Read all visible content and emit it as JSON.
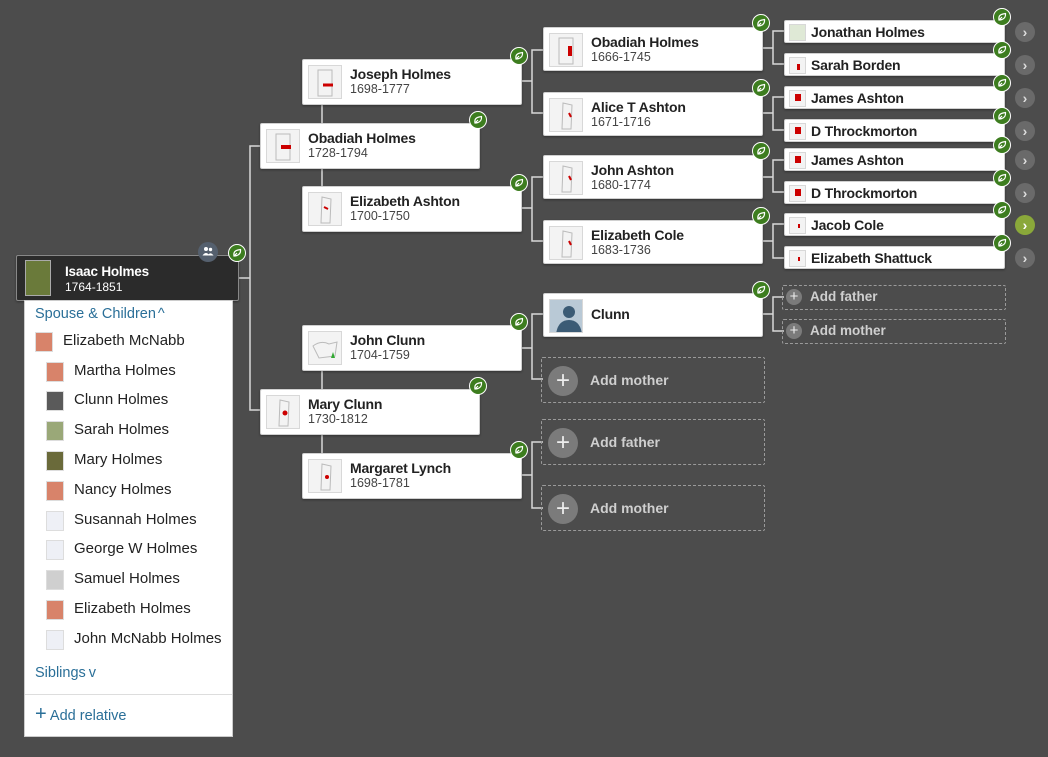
{
  "tree": {
    "root": {
      "name": "Isaac Holmes",
      "dates": "1764-1851"
    },
    "gen1": [
      {
        "name": "Obadiah Holmes",
        "dates": "1728-1794"
      },
      {
        "name": "Mary Clunn",
        "dates": "1730-1812"
      }
    ],
    "gen2": [
      {
        "name": "Joseph Holmes",
        "dates": "1698-1777"
      },
      {
        "name": "Elizabeth Ashton",
        "dates": "1700-1750"
      },
      {
        "name": "John Clunn",
        "dates": "1704-1759"
      },
      {
        "name": "Margaret Lynch",
        "dates": "1698-1781"
      }
    ],
    "gen3": [
      {
        "name": "Obadiah Holmes",
        "dates": "1666-1745"
      },
      {
        "name": "Alice T Ashton",
        "dates": "1671-1716"
      },
      {
        "name": "John Ashton",
        "dates": "1680-1774"
      },
      {
        "name": "Elizabeth Cole",
        "dates": "1683-1736"
      },
      {
        "name": "Clunn",
        "dates": ""
      }
    ],
    "gen4": [
      {
        "name": "Jonathan Holmes"
      },
      {
        "name": "Sarah Borden"
      },
      {
        "name": "James Ashton"
      },
      {
        "name": "D Throckmorton"
      },
      {
        "name": "James Ashton"
      },
      {
        "name": "D Throckmorton"
      },
      {
        "name": "Jacob Cole"
      },
      {
        "name": "Elizabeth Shattuck"
      }
    ],
    "add_father": "Add father",
    "add_mother": "Add mother",
    "more_arrow": "›"
  },
  "panel": {
    "spouse_children_label": "Spouse & Children",
    "spouse_chevron": "^",
    "spouse": "Elizabeth McNabb",
    "children": [
      "Martha Holmes",
      "Clunn Holmes",
      "Sarah Holmes",
      "Mary Holmes",
      "Nancy Holmes",
      "Susannah Holmes",
      "George W Holmes",
      "Samuel Holmes",
      "Elizabeth Holmes",
      "John McNabb Holmes"
    ],
    "siblings_label": "Siblings",
    "siblings_chevron": "v",
    "add_relative": "Add relative",
    "plus": "+"
  },
  "colors": {
    "background": "#4c4c4c",
    "hint_leaf": "#3d7d1f",
    "link": "#2a6f98",
    "connector": "#d8d8d8"
  },
  "icons": [
    "hint-leaf-icon",
    "family-group-icon",
    "chevron-right-icon",
    "plus-icon",
    "chevron-up-icon",
    "chevron-down-icon"
  ]
}
